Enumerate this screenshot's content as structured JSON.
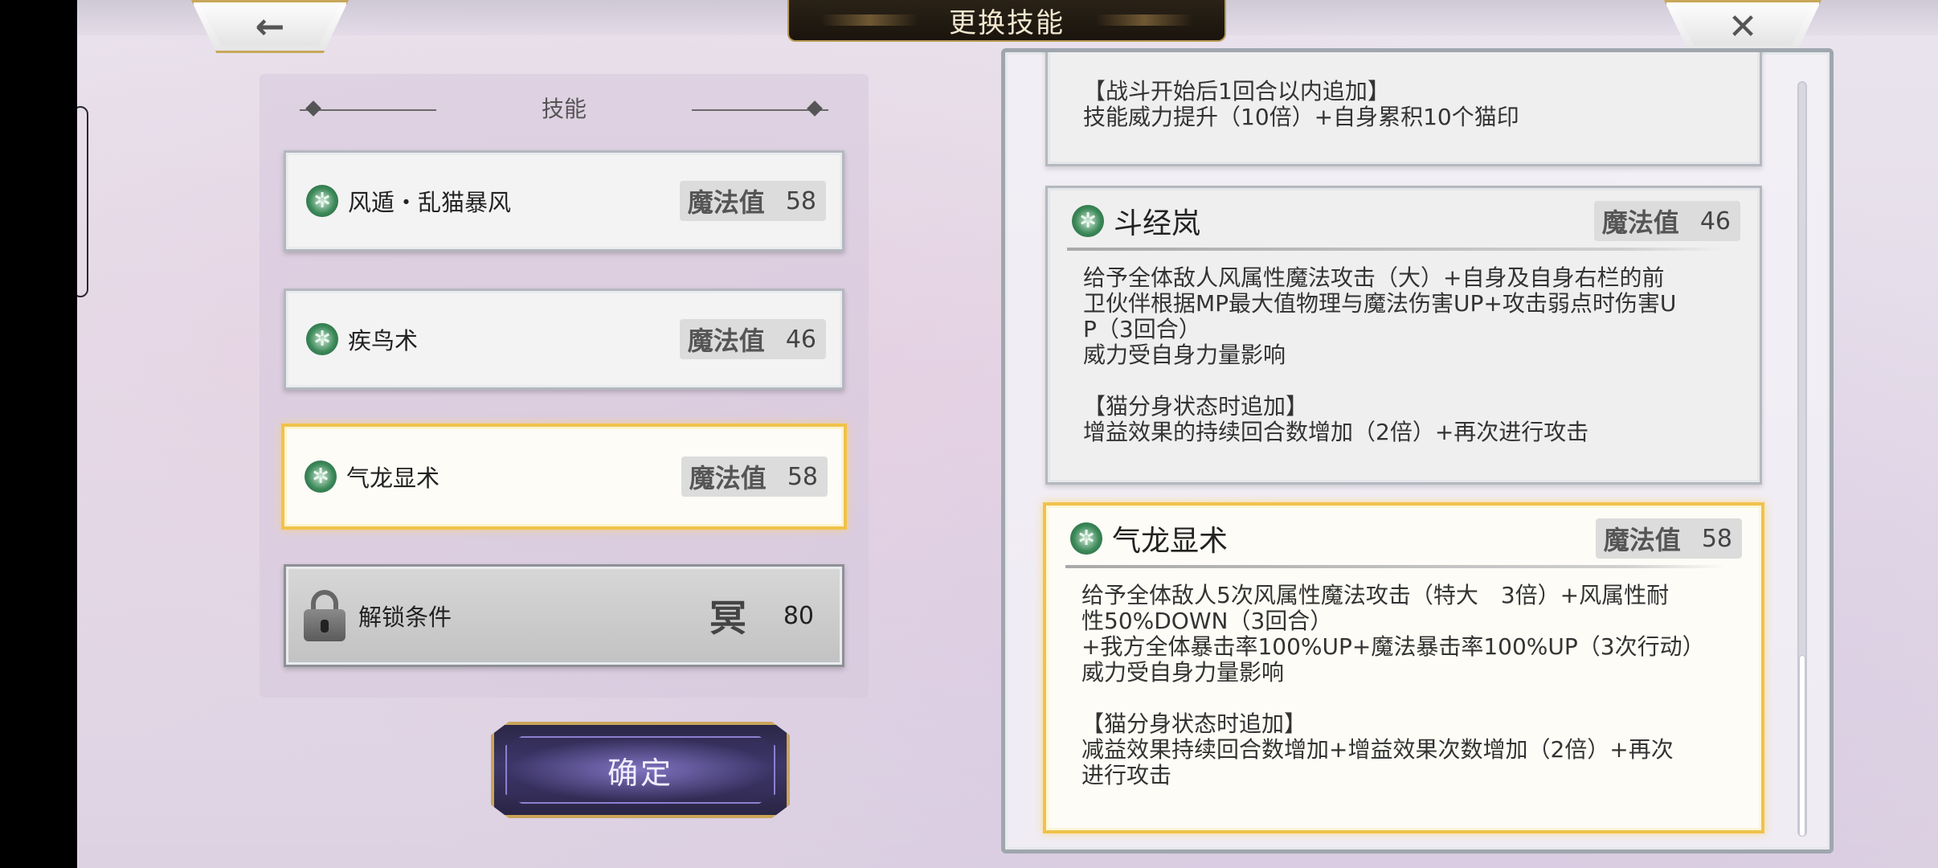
{
  "title": "更换技能",
  "nav": {
    "back_glyph": "←",
    "close_glyph": "✕"
  },
  "left": {
    "header": "技能",
    "skills": [
      {
        "name": "风遁・乱猫暴风",
        "mp_label": "魔法值",
        "mp": "58",
        "icon": "wind-emblem-icon"
      },
      {
        "name": "疾鸟术",
        "mp_label": "魔法值",
        "mp": "46",
        "icon": "wind-emblem-icon"
      },
      {
        "name": "气龙显术",
        "mp_label": "魔法值",
        "mp": "58",
        "icon": "wind-emblem-icon",
        "selected": true
      }
    ],
    "locked": {
      "label": "解锁条件",
      "cost_icon": "冥",
      "cost": "80"
    },
    "confirm": "确定"
  },
  "right": {
    "partial_text": "【战斗开始后1回合以内追加】\n技能威力提升（10倍）+自身累积10个猫印",
    "details": [
      {
        "name": "斗经岚",
        "mp_label": "魔法值",
        "mp": "46",
        "text": "给予全体敌人风属性魔法攻击（大）+自身及自身右栏的前\n卫伙伴根据MP最大值物理与魔法伤害UP+攻击弱点时伤害U\nP（3回合）\n威力受自身力量影响\n\n【猫分身状态时追加】\n增益效果的持续回合数增加（2倍）+再次进行攻击"
      },
      {
        "name": "气龙显术",
        "mp_label": "魔法值",
        "mp": "58",
        "text": "给予全体敌人5次风属性魔法攻击（特大　3倍）+风属性耐\n性50%DOWN（3回合）\n+我方全体暴击率100%UP+魔法暴击率100%UP（3次行动）\n威力受自身力量影响\n\n【猫分身状态时追加】\n减益效果持续回合数增加+增益效果次数增加（2倍）+再次\n进行攻击"
      }
    ]
  }
}
